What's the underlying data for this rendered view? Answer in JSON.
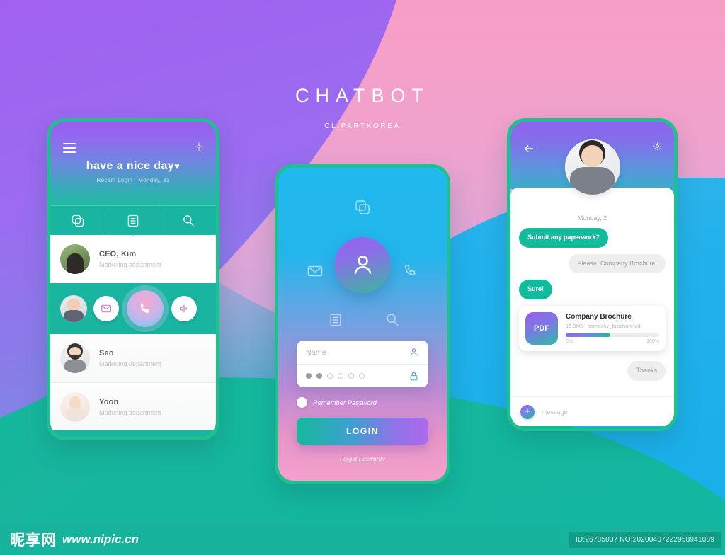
{
  "header": {
    "title": "CHATBOT",
    "subtitle": "CLIPARTKOREA"
  },
  "colors": {
    "accent_teal": "#1ab5a1",
    "border_green": "#1fc08f",
    "purple": "#9b5ef1",
    "pink": "#f39ecb",
    "blue": "#23b1ec",
    "bubble_me": "#13bb9d",
    "bubble_them": "#eeeeee"
  },
  "phone_left": {
    "menu_icon": "hamburger-icon",
    "settings_icon": "gear-icon",
    "greeting": "have a nice day",
    "greeting_heart": "♥",
    "recent_login_label": "Recent Login",
    "recent_login_date": "Monday, 31",
    "tabs": [
      {
        "icon": "copy-icon",
        "active": false
      },
      {
        "icon": "document-icon",
        "active": true
      },
      {
        "icon": "search-icon",
        "active": false
      }
    ],
    "contacts": [
      {
        "name": "CEO, Kim",
        "department": "Marketing department"
      },
      {
        "name": "Seo",
        "department": "Marketing department"
      },
      {
        "name": "Yoon",
        "department": "Marketing department"
      }
    ],
    "actions": [
      {
        "icon": "avatar-icon"
      },
      {
        "icon": "mail-icon"
      },
      {
        "icon": "phone-icon"
      },
      {
        "icon": "speaker-icon"
      }
    ]
  },
  "phone_center": {
    "hub_icons": [
      {
        "icon": "copy-icon"
      },
      {
        "icon": "mail-icon"
      },
      {
        "icon": "phone-icon"
      },
      {
        "icon": "document-icon"
      },
      {
        "icon": "search-icon"
      }
    ],
    "center_icon": "user-icon",
    "form": {
      "name_placeholder": "Name",
      "name_icon": "user-icon",
      "password_icon": "lock-icon",
      "password_dots_filled": 2,
      "password_dots_total": 6,
      "remember_label": "Remember Password",
      "remember_checked": false,
      "login_label": "LOGIN",
      "forgot_label": "Forget Pasword?"
    }
  },
  "phone_right": {
    "back_icon": "back-arrow-icon",
    "settings_icon": "gear-icon",
    "avatar": "profile-avatar",
    "date": "Monday, 2",
    "messages": [
      {
        "side": "me",
        "text": "Submit any paperwork?"
      },
      {
        "side": "them",
        "text": "Please, Company Brochure."
      },
      {
        "side": "me",
        "text": "Sure!"
      }
    ],
    "file_card": {
      "badge": "PDF",
      "title": "Company Brochure",
      "size": "15.3MB",
      "filename": "company_brochure.pdf",
      "progress_percent": 48,
      "min_label": "0%",
      "max_label": "100%"
    },
    "last_message": {
      "side": "them",
      "text": "Thanks"
    },
    "input": {
      "add_icon": "plus-icon",
      "placeholder": "message"
    }
  },
  "footer": {
    "logo": "昵享网",
    "url": "www.nipic.cn",
    "id_text": "ID:26785037 NO:20200407222958941089"
  }
}
